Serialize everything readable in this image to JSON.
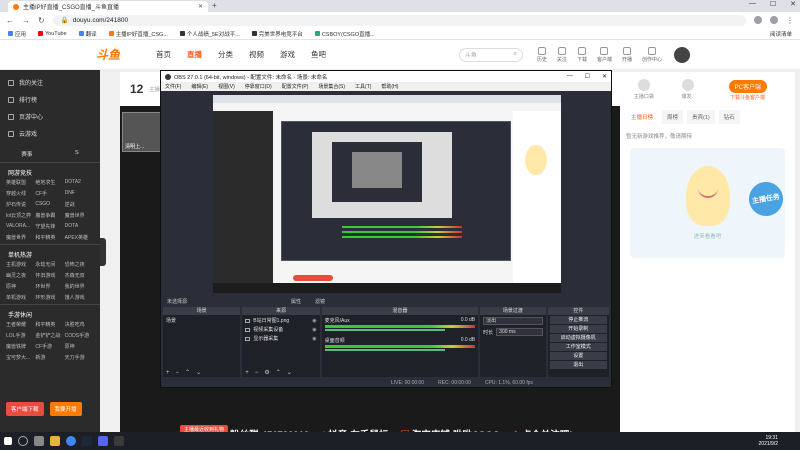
{
  "browser": {
    "tab_title": "主播IP好直播_CSGO直播_斗鱼直播",
    "url": "douyu.com/241800",
    "bookmarks": [
      "应用",
      "YouTube",
      "翻译",
      "主播IP好直播_CSG...",
      "个人战绩_5E对战平...",
      "完美世界电竞平台",
      "CSBOY(CSGO直播..."
    ],
    "bookmark_right": "阅读清单"
  },
  "site": {
    "logo": "斗鱼",
    "nav": [
      "首页",
      "直播",
      "分类",
      "视频",
      "游戏",
      "鱼吧"
    ],
    "search_placeholder": "斗鱼",
    "header_icons": [
      "历史",
      "关注",
      "下载",
      "客户端",
      "开播",
      "创作中心"
    ]
  },
  "sidebar": {
    "main": [
      "我的关注",
      "排行榜",
      "页游中心",
      "云游戏"
    ],
    "row": [
      "赛事",
      "S"
    ],
    "sections": [
      {
        "title": "网游竞技",
        "items": [
          "英雄联盟",
          "绝地求生",
          "DOTA2",
          "穿越火线",
          "CF手",
          "DNF",
          "炉石传说",
          "CSGO",
          "逆战",
          "lol云顶之弈",
          "魔兽争霸",
          "魔兽世界",
          "VALORA...",
          "守望先锋",
          "DOTA",
          "魔兽世界",
          "和平精英",
          "APEX英雄"
        ]
      },
      {
        "title": "单机热游",
        "items": [
          "主机游戏",
          "永劫无间",
          "恐怖之夜",
          "幽灵之夜",
          "怀旧游戏",
          "杰森无双",
          "原神",
          "环世界",
          "我的世界",
          "单机游戏",
          "环形游戏",
          "饿人游戏"
        ]
      },
      {
        "title": "手游休闲",
        "items": [
          "王者荣耀",
          "和平精英",
          "决胜吃鸡",
          "LOL手游",
          "金铲铲之战",
          "CODS手游",
          "魔兽铁牌",
          "CF手游",
          "原神",
          "宝可梦大...",
          "新游",
          "天刀手游"
        ]
      }
    ],
    "bottom_buttons": [
      "客户端下载",
      "我要开播"
    ]
  },
  "room": {
    "number": "12",
    "sub": "主播昵称"
  },
  "right_panel": {
    "icons": [
      "主播口袋",
      "爆发"
    ],
    "pc_button": "PC客户端",
    "sub": "下载斗鱼客户端",
    "tabs": [
      "主播日榜",
      "周榜",
      "贵宾(1)",
      "钻石"
    ],
    "note": "暂无新游戏推荐，敬请期待",
    "mascot_caption": "进来看看吧",
    "badge": "主播任务"
  },
  "thumb_label": "清明上...",
  "obs": {
    "title": "OBS 27.0.1 (64-bit, windows) - 配置文件: 未命名 - 场景: 未命名",
    "menu": [
      "文件(F)",
      "编辑(E)",
      "视图(V)",
      "停靠窗口(D)",
      "配置文件(P)",
      "场景集合(S)",
      "工具(T)",
      "帮助(H)"
    ],
    "toolbar": [
      "未选择源",
      "属性",
      "滤镜"
    ],
    "docks": {
      "scenes": {
        "header": "场景",
        "items": [
          "场景"
        ]
      },
      "sources": {
        "header": "来源",
        "items": [
          "B站日常图1.png",
          "视频采集设备",
          "显示器采集"
        ]
      },
      "mixer": {
        "header": "混音器",
        "rows": [
          {
            "label": "麦克风/Aux",
            "value": "0.0 dB"
          },
          {
            "label": "桌面音频",
            "value": "0.0 dB"
          }
        ]
      },
      "transitions": {
        "header": "场景过渡",
        "type": "淡出",
        "duration_label": "时长",
        "duration": "300 ms"
      },
      "controls": {
        "header": "控件",
        "buttons": [
          "停止推流",
          "开始录制",
          "启动虚拟摄像机",
          "工作室模式",
          "设置",
          "退出"
        ]
      }
    },
    "status": [
      "LIVE: 00:00:00",
      "REC: 00:00:00",
      "CPU: 1.1%, 60.00 fps"
    ]
  },
  "overlay": {
    "live_chip": "主播最近收到礼物",
    "group": "粉丝群:456722912",
    "douyin": "抖音:左手鼠标",
    "taobao": "淘宝店铺:咻咻CSGO",
    "follow": "点个关注吧!"
  },
  "taskbar": {
    "time": "19:31",
    "date": "2021/9/2"
  },
  "colors": {
    "accent": "#ff7a00",
    "live_red": "#e74c3c",
    "obs_bg": "#2b2e38"
  }
}
